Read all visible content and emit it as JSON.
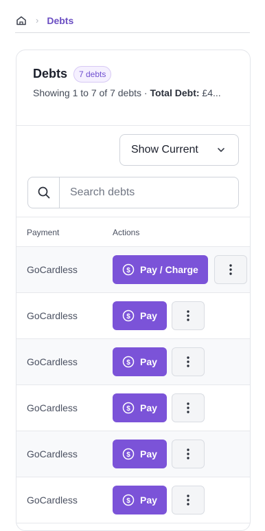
{
  "breadcrumb": {
    "current": "Debts"
  },
  "card": {
    "title": "Debts",
    "badge": "7 debts",
    "summary_prefix": "Showing 1 to 7 of 7 debts · ",
    "summary_label": "Total Debt:",
    "summary_value": " £4..."
  },
  "filter": {
    "selected": "Show Current"
  },
  "search": {
    "placeholder": "Search debts",
    "value": ""
  },
  "table": {
    "columns": [
      "Payment",
      "Actions"
    ],
    "rows": [
      {
        "method": "GoCardless",
        "action": "Pay / Charge"
      },
      {
        "method": "GoCardless",
        "action": "Pay"
      },
      {
        "method": "GoCardless",
        "action": "Pay"
      },
      {
        "method": "GoCardless",
        "action": "Pay"
      },
      {
        "method": "GoCardless",
        "action": "Pay"
      },
      {
        "method": "GoCardless",
        "action": "Pay"
      }
    ]
  },
  "icons": {
    "home": "home-icon",
    "chevron": "chevron-down-icon",
    "search": "search-icon",
    "coin": "coin-icon",
    "more": "more-vertical-icon"
  },
  "colors": {
    "accent": "#7b53d8",
    "brand_text": "#6a4dc2"
  }
}
